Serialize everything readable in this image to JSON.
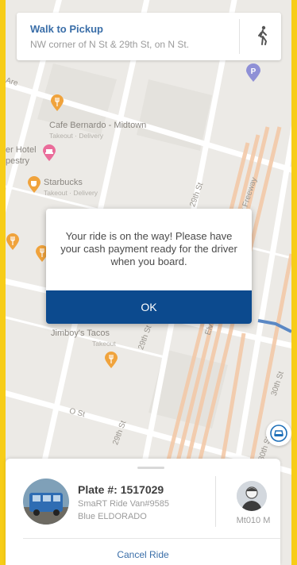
{
  "walk_card": {
    "title": "Walk to Pickup",
    "subtitle": "NW corner of N St & 29th St, on N St.",
    "icon": "walking-person-icon"
  },
  "map": {
    "places": [
      {
        "name": "Cafe Bernardo - Midtown",
        "sub": "Takeout · Delivery"
      },
      {
        "name": "er Hotel",
        "sub": ""
      },
      {
        "name": "pestry",
        "sub": ""
      },
      {
        "name": "Starbucks",
        "sub": "Takeout · Delivery"
      },
      {
        "name": "Jimboy's Tacos",
        "sub": "Takeout"
      }
    ],
    "streets": [
      "29th St",
      "29th St",
      "29th St",
      "O St",
      "Capital City Freeway",
      "Elv",
      "30th St",
      "30th St",
      "Are"
    ],
    "parking_marker": "P",
    "colors": {
      "background": "#eceae6",
      "freeway": "#f3c9a8",
      "route": "#5b88c4",
      "frame": "#F7CD18"
    }
  },
  "modal": {
    "message": "Your ride is on the way! Please have your cash payment ready for the driver when you board.",
    "ok_label": "OK",
    "ok_color": "#0C4A8E"
  },
  "sheet": {
    "plate": "Plate #: 1517029",
    "vehicle_name": "SmaRT Ride Van#9585",
    "vehicle_desc": "Blue ELDORADO",
    "driver_id": "Mt010 M",
    "cancel_label": "Cancel Ride"
  }
}
